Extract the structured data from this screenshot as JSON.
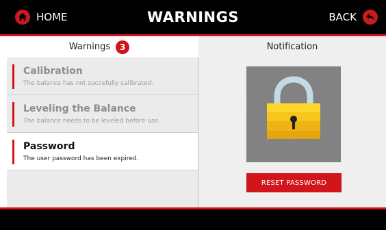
{
  "header": {
    "title": "WARNINGS",
    "home_label": "HOME",
    "back_label": "BACK"
  },
  "tabs": {
    "warnings_label": "Warnings",
    "warnings_count": "3",
    "notification_label": "Notification"
  },
  "warnings": [
    {
      "title": "Calibration",
      "description": "The balance has not succefully calibrated."
    },
    {
      "title": "Leveling the Balance",
      "description": "The balance needs to be leveled before use."
    },
    {
      "title": "Password",
      "description": "The user password has been expired."
    }
  ],
  "notification": {
    "icon": "padlock-icon",
    "action_label": "RESET PASSWORD"
  },
  "colors": {
    "accent": "#d2151b",
    "bar": "#000000"
  }
}
